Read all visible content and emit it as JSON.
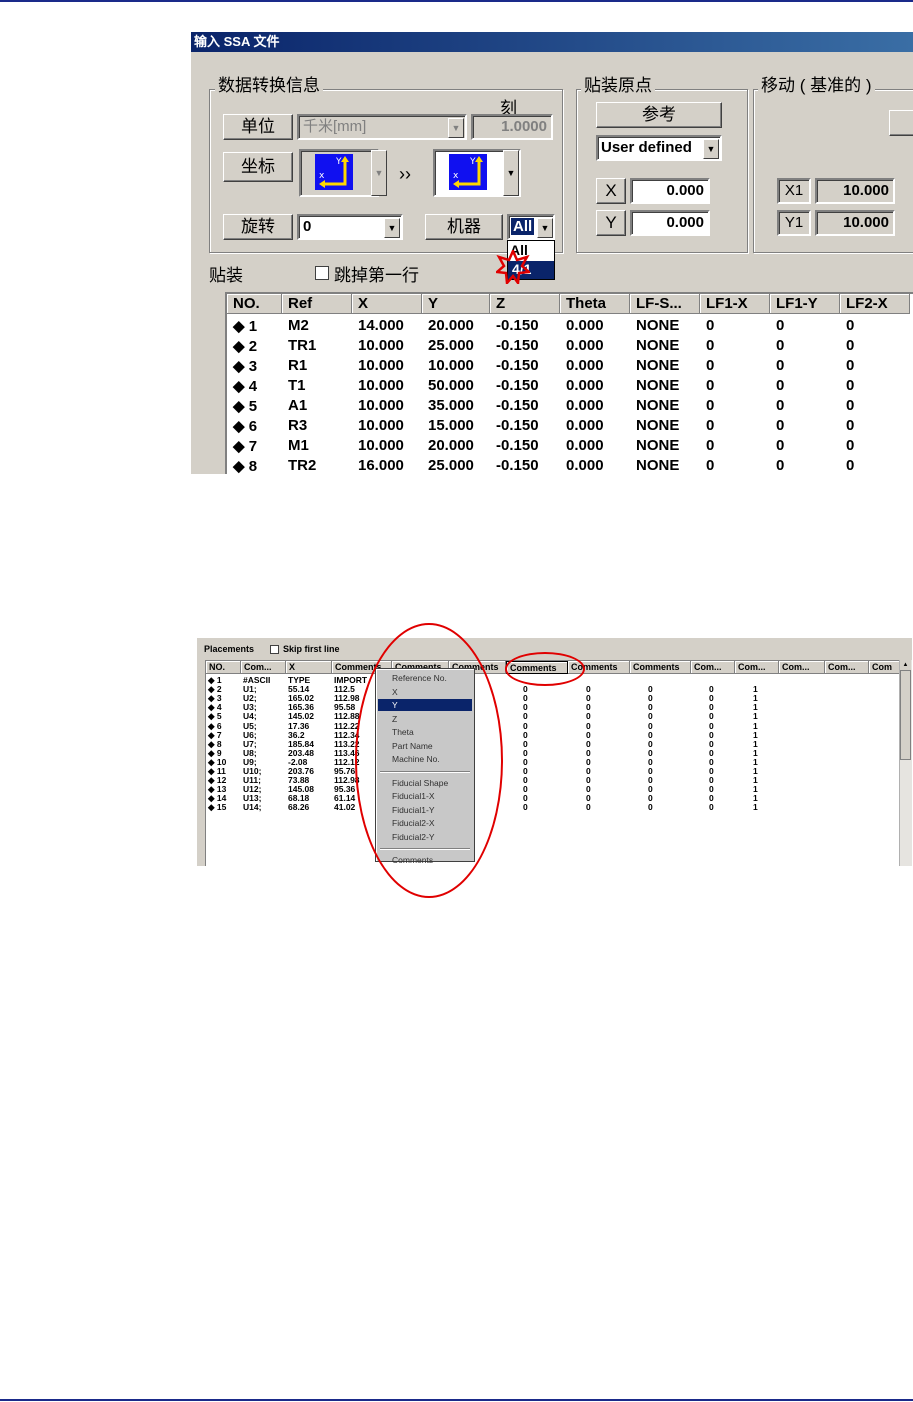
{
  "shot1": {
    "title": "输入 SSA 文件",
    "conversion": {
      "group_title": "数据转换信息",
      "scale_label": "刻",
      "unit_label": "单位",
      "unit_value": "千米[mm]",
      "scale_value": "1.0000",
      "coord_label": "坐标",
      "arrow_text": "››",
      "rotate_label": "旋转",
      "rotate_value": "0",
      "machine_label": "机器",
      "machine_value": "All",
      "machine_options": [
        "All",
        "4/1"
      ]
    },
    "origin": {
      "group_title": "贴装原点",
      "reference_button": "参考",
      "mode_value": "User defined",
      "x_label": "X",
      "x_value": "0.000",
      "y_label": "Y",
      "y_value": "0.000"
    },
    "move": {
      "group_title": "移动 ( 基准的 )",
      "x1_label": "X1",
      "x1_value": "10.000",
      "y1_label": "Y1",
      "y1_value": "10.000"
    },
    "placement": {
      "label": "贴装",
      "skip_label": "跳掉第一行",
      "columns": [
        "NO.",
        "Ref",
        "X",
        "Y",
        "Z",
        "Theta",
        "LF-S...",
        "LF1-X",
        "LF1-Y",
        "LF2-X"
      ],
      "rows": [
        [
          "◆ 1",
          "M2",
          "14.000",
          "20.000",
          "-0.150",
          "0.000",
          "NONE",
          "0",
          "0",
          "0"
        ],
        [
          "◆ 2",
          "TR1",
          "10.000",
          "25.000",
          "-0.150",
          "0.000",
          "NONE",
          "0",
          "0",
          "0"
        ],
        [
          "◆ 3",
          "R1",
          "10.000",
          "10.000",
          "-0.150",
          "0.000",
          "NONE",
          "0",
          "0",
          "0"
        ],
        [
          "◆ 4",
          "T1",
          "10.000",
          "50.000",
          "-0.150",
          "0.000",
          "NONE",
          "0",
          "0",
          "0"
        ],
        [
          "◆ 5",
          "A1",
          "10.000",
          "35.000",
          "-0.150",
          "0.000",
          "NONE",
          "0",
          "0",
          "0"
        ],
        [
          "◆ 6",
          "R3",
          "10.000",
          "15.000",
          "-0.150",
          "0.000",
          "NONE",
          "0",
          "0",
          "0"
        ],
        [
          "◆ 7",
          "M1",
          "10.000",
          "20.000",
          "-0.150",
          "0.000",
          "NONE",
          "0",
          "0",
          "0"
        ],
        [
          "◆ 8",
          "TR2",
          "16.000",
          "25.000",
          "-0.150",
          "0.000",
          "NONE",
          "0",
          "0",
          "0"
        ]
      ]
    }
  },
  "shot2": {
    "placements_label": "Placements",
    "skip_label": "Skip first line",
    "columns": [
      "NO.",
      "Com...",
      "X",
      "Comments",
      "Comments",
      "Comments",
      "Comments",
      "Comments",
      "Comments",
      "Com...",
      "Com...",
      "Com...",
      "Com...",
      "Com"
    ],
    "rows": [
      [
        "◆ 1",
        "#ASCII",
        "TYPE",
        "IMPORT",
        "",
        "",
        ""
      ],
      [
        "◆ 2",
        "U1;",
        "55.14",
        "112.5",
        "0",
        "0",
        "0",
        "0",
        "1"
      ],
      [
        "◆ 3",
        "U2;",
        "165.02",
        "112.98",
        "0",
        "0",
        "0",
        "0",
        "1"
      ],
      [
        "◆ 4",
        "U3;",
        "165.36",
        "95.58",
        "0",
        "0",
        "0",
        "0",
        "1"
      ],
      [
        "◆ 5",
        "U4;",
        "145.02",
        "112.88",
        "0",
        "0",
        "0",
        "0",
        "1"
      ],
      [
        "◆ 6",
        "U5;",
        "17.36",
        "112.22",
        "0",
        "0",
        "0",
        "0",
        "1"
      ],
      [
        "◆ 7",
        "U6;",
        "36.2",
        "112.34",
        "0",
        "0",
        "0",
        "0",
        "1"
      ],
      [
        "◆ 8",
        "U7;",
        "185.84",
        "113.22",
        "0",
        "0",
        "0",
        "0",
        "1"
      ],
      [
        "◆ 9",
        "U8;",
        "203.48",
        "113.46",
        "0",
        "0",
        "0",
        "0",
        "1"
      ],
      [
        "◆ 10",
        "U9;",
        "-2.08",
        "112.12",
        "0",
        "0",
        "0",
        "0",
        "1"
      ],
      [
        "◆ 11",
        "U10;",
        "203.76",
        "95.76",
        "0",
        "0",
        "0",
        "0",
        "1"
      ],
      [
        "◆ 12",
        "U11;",
        "73.88",
        "112.98",
        "0",
        "0",
        "0",
        "0",
        "1"
      ],
      [
        "◆ 13",
        "U12;",
        "145.08",
        "95.36",
        "0",
        "0",
        "0",
        "0",
        "1"
      ],
      [
        "◆ 14",
        "U13;",
        "68.18",
        "61.14",
        "0",
        "0",
        "0",
        "0",
        "1"
      ],
      [
        "◆ 15",
        "U14;",
        "68.26",
        "41.02",
        "0",
        "0",
        "0",
        "0",
        "1"
      ]
    ],
    "menu_items": [
      "Reference No.",
      "X",
      "Y",
      "Z",
      "Theta",
      "Part Name",
      "Machine No.",
      "",
      "Fiducial Shape",
      "Fiducial1-X",
      "Fiducial1-Y",
      "Fiducial2-X",
      "Fiducial2-Y",
      "",
      "Comments"
    ],
    "menu_selected": "Y"
  },
  "colors": {
    "title_bar": "#0a246a",
    "dialog_face": "#d4d0c8",
    "highlight": "#0a246a",
    "annotation": "#e00000"
  }
}
